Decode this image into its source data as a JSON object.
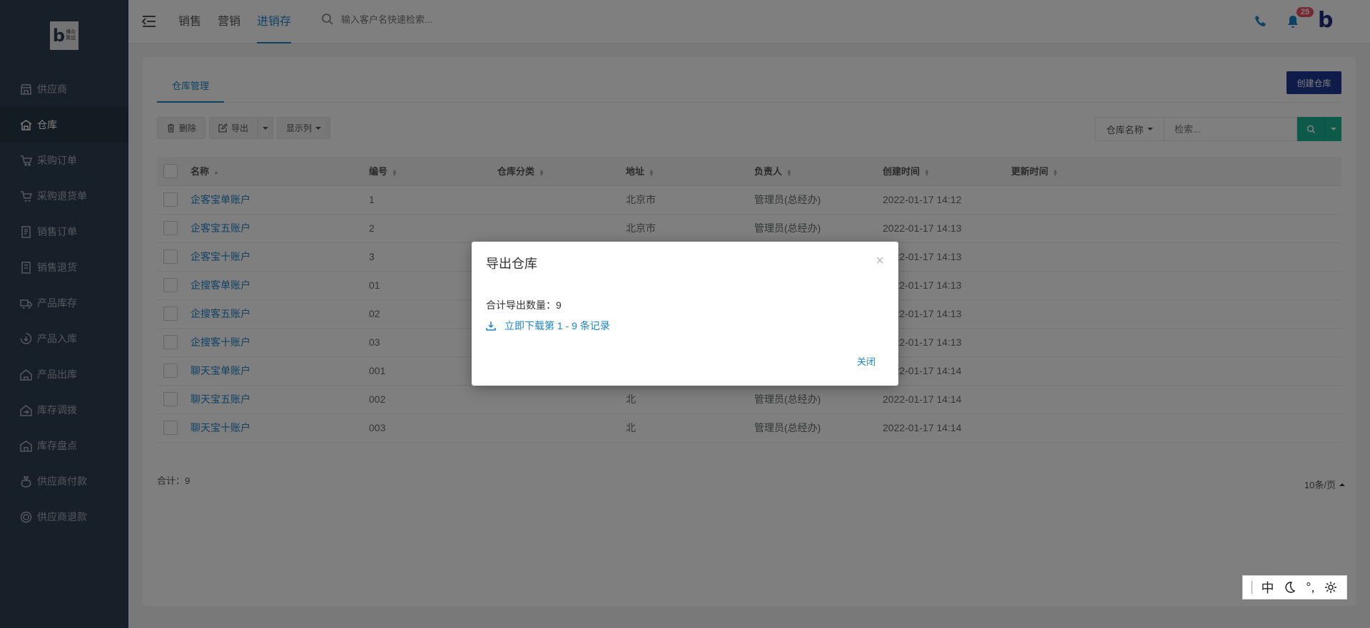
{
  "sidebar": {
    "logo_letter": "b",
    "logo_text_line1": "博众",
    "logo_text_line2": "致远",
    "items": [
      {
        "label": "供应商",
        "icon": "store-icon"
      },
      {
        "label": "仓库",
        "icon": "warehouse-icon"
      },
      {
        "label": "采购订单",
        "icon": "cart-icon"
      },
      {
        "label": "采购退货单",
        "icon": "cart-return-icon"
      },
      {
        "label": "销售订单",
        "icon": "order-icon"
      },
      {
        "label": "销售退货",
        "icon": "return-doc-icon"
      },
      {
        "label": "产品库存",
        "icon": "truck-icon"
      },
      {
        "label": "产品入库",
        "icon": "inbound-icon"
      },
      {
        "label": "产品出库",
        "icon": "outbound-icon"
      },
      {
        "label": "库存调拨",
        "icon": "transfer-icon"
      },
      {
        "label": "库存盘点",
        "icon": "inventory-icon"
      },
      {
        "label": "供应商付款",
        "icon": "money-bag-icon"
      },
      {
        "label": "供应商退款",
        "icon": "refund-icon"
      }
    ],
    "active_index": 1
  },
  "header": {
    "tabs": [
      "销售",
      "营销",
      "进销存"
    ],
    "active_tab": 2,
    "search_placeholder": "输入客户名快速检索...",
    "notification_count": "25",
    "avatar_letter": "b"
  },
  "panel": {
    "tab_label": "仓库管理",
    "create_button": "创建仓库",
    "toolbar": {
      "delete": "删除",
      "export": "导出",
      "columns": "显示列"
    },
    "search": {
      "field_select": "仓库名称",
      "placeholder": "检索..."
    },
    "columns": [
      "名称",
      "编号",
      "仓库分类",
      "地址",
      "负责人",
      "创建时间",
      "更新时间"
    ],
    "rows": [
      {
        "name": "企客宝单账户",
        "code": "1",
        "category": "",
        "address": "北京市",
        "owner": "管理员(总经办)",
        "created": "2022-01-17 14:12",
        "updated": ""
      },
      {
        "name": "企客宝五账户",
        "code": "2",
        "category": "",
        "address": "北京市",
        "owner": "管理员(总经办)",
        "created": "2022-01-17 14:13",
        "updated": ""
      },
      {
        "name": "企客宝十账户",
        "code": "3",
        "category": "",
        "address": "",
        "owner": "",
        "created": "2022-01-17 14:13",
        "updated": ""
      },
      {
        "name": "企搜客单账户",
        "code": "01",
        "category": "",
        "address": "",
        "owner": "",
        "created": "2022-01-17 14:13",
        "updated": ""
      },
      {
        "name": "企搜客五账户",
        "code": "02",
        "category": "",
        "address": "",
        "owner": "",
        "created": "2022-01-17 14:13",
        "updated": ""
      },
      {
        "name": "企搜客十账户",
        "code": "03",
        "category": "",
        "address": "",
        "owner": "",
        "created": "2022-01-17 14:13",
        "updated": ""
      },
      {
        "name": "聊天宝单账户",
        "code": "001",
        "category": "",
        "address": "",
        "owner": "",
        "created": "2022-01-17 14:14",
        "updated": ""
      },
      {
        "name": "聊天宝五账户",
        "code": "002",
        "category": "",
        "address": "北",
        "owner": "管理员(总经办)",
        "created": "2022-01-17 14:14",
        "updated": ""
      },
      {
        "name": "聊天宝十账户",
        "code": "003",
        "category": "",
        "address": "北",
        "owner": "管理员(总经办)",
        "created": "2022-01-17 14:14",
        "updated": ""
      }
    ],
    "total": "合计：9",
    "page_size": "10条/页"
  },
  "modal": {
    "title": "导出仓库",
    "count_text": "合计导出数量：9",
    "download_link": "立即下载第 1 - 9 条记录",
    "close_button": "关闭",
    "close_x": "×"
  },
  "ime": {
    "mode": "中",
    "punct": "°,"
  },
  "colors": {
    "sidebar": "#2f4050",
    "accent": "#1c84c6",
    "primary_button": "#1f3693",
    "search_button": "#1ab394",
    "badge": "#ed5565"
  }
}
